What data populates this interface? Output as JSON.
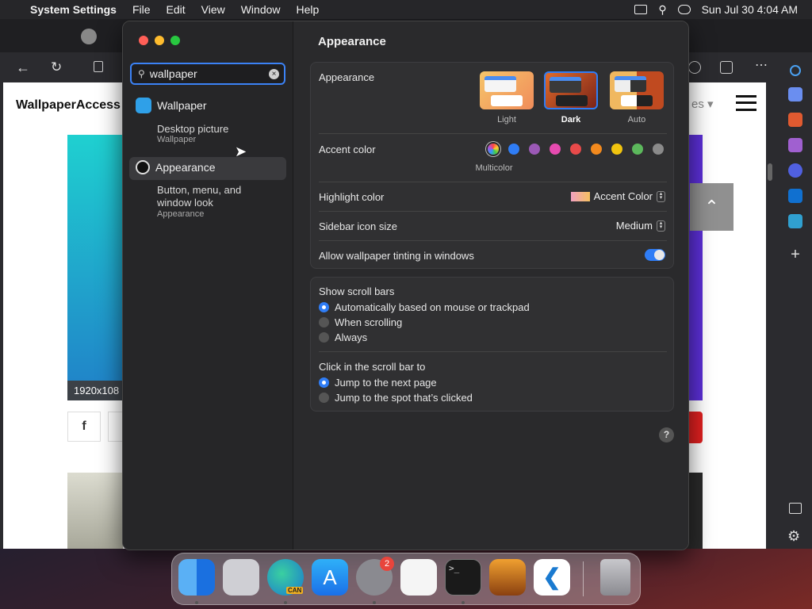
{
  "menubar": {
    "app_name": "System Settings",
    "menus": [
      "File",
      "Edit",
      "View",
      "Window",
      "Help"
    ],
    "clock": "Sun Jul 30  4:04 AM"
  },
  "browser": {
    "site_title": "WallpaperAccess",
    "resolution": "1920x108",
    "pages_label": "es",
    "fb_label": "f"
  },
  "settings": {
    "search": {
      "value": "wallpaper"
    },
    "results": [
      {
        "title": "Wallpaper",
        "desc": "Desktop picture",
        "sub": "Wallpaper"
      },
      {
        "title": "Appearance",
        "desc": "Button, menu, and window look",
        "sub": "Appearance"
      }
    ],
    "page_title": "Appearance",
    "appearance": {
      "label": "Appearance",
      "options": [
        "Light",
        "Dark",
        "Auto"
      ],
      "selected": "Dark"
    },
    "accent": {
      "label": "Accent color",
      "multicolor_label": "Multicolor",
      "colors": [
        "#2f7df6",
        "#9b59b6",
        "#e64bb0",
        "#e84a4a",
        "#f28a1e",
        "#f1c40f",
        "#5cb85c",
        "#8a8a8a"
      ]
    },
    "highlight": {
      "label": "Highlight color",
      "value": "Accent Color"
    },
    "sidebar_icon_size": {
      "label": "Sidebar icon size",
      "value": "Medium"
    },
    "tinting": {
      "label": "Allow wallpaper tinting in windows",
      "on": true
    },
    "scroll_bars": {
      "label": "Show scroll bars",
      "options": [
        "Automatically based on mouse or trackpad",
        "When scrolling",
        "Always"
      ],
      "selected": 0
    },
    "click_scroll": {
      "label": "Click in the scroll bar to",
      "options": [
        "Jump to the next page",
        "Jump to the spot that’s clicked"
      ],
      "selected": 0
    },
    "help": "?"
  },
  "dock": {
    "settings_badge": "2",
    "edge_label": "CAN"
  }
}
